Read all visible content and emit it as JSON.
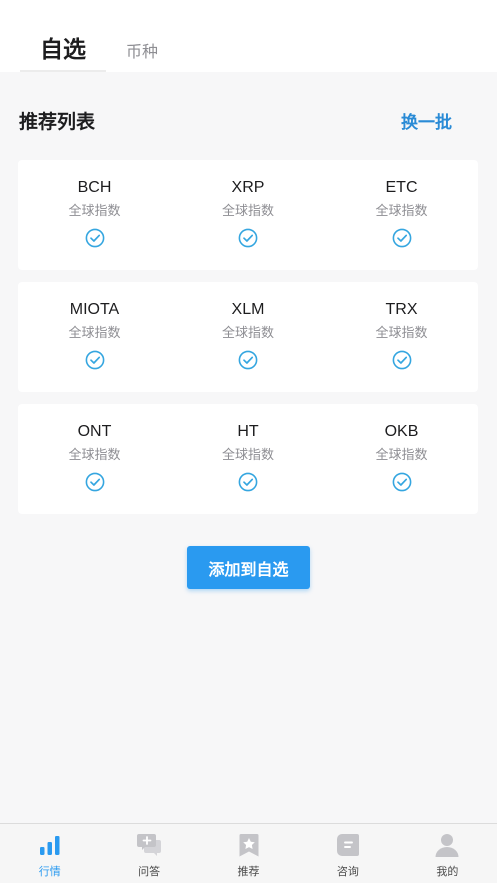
{
  "header": {
    "tabs": [
      {
        "label": "自选",
        "active": true
      },
      {
        "label": "币种",
        "active": false
      }
    ]
  },
  "recommend": {
    "title": "推荐列表",
    "refresh_label": "换一批",
    "rows": [
      [
        {
          "symbol": "BCH",
          "subtitle": "全球指数",
          "selected": true
        },
        {
          "symbol": "XRP",
          "subtitle": "全球指数",
          "selected": true
        },
        {
          "symbol": "ETC",
          "subtitle": "全球指数",
          "selected": true
        }
      ],
      [
        {
          "symbol": "MIOTA",
          "subtitle": "全球指数",
          "selected": true
        },
        {
          "symbol": "XLM",
          "subtitle": "全球指数",
          "selected": true
        },
        {
          "symbol": "TRX",
          "subtitle": "全球指数",
          "selected": true
        }
      ],
      [
        {
          "symbol": "ONT",
          "subtitle": "全球指数",
          "selected": true
        },
        {
          "symbol": "HT",
          "subtitle": "全球指数",
          "selected": true
        },
        {
          "symbol": "OKB",
          "subtitle": "全球指数",
          "selected": true
        }
      ]
    ],
    "add_button_label": "添加到自选"
  },
  "bottom_nav": {
    "items": [
      {
        "label": "行情",
        "icon": "bar-chart-icon",
        "active": true
      },
      {
        "label": "问答",
        "icon": "chat-bubble-icon",
        "active": false
      },
      {
        "label": "推荐",
        "icon": "bookmark-star-icon",
        "active": false
      },
      {
        "label": "咨询",
        "icon": "news-icon",
        "active": false
      },
      {
        "label": "我的",
        "icon": "user-icon",
        "active": false
      }
    ]
  },
  "colors": {
    "accent": "#2a9af0",
    "link": "#2a8bd6",
    "check": "#35a6e0",
    "nav_inactive": "#c4c4c8",
    "background": "#f7f7f8"
  }
}
